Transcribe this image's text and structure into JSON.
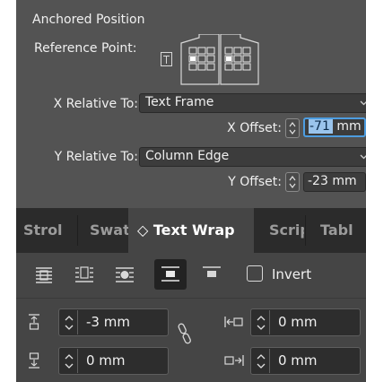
{
  "anchored_position": {
    "title": "Anchored Position",
    "reference_point_label": "Reference Point:",
    "x_relative_to_label": "X Relative To:",
    "x_relative_to_value": "Text Frame",
    "x_offset_label": "X Offset:",
    "x_offset_value": "-71",
    "x_offset_unit": " mm",
    "y_relative_to_label": "Y Relative To:",
    "y_relative_to_value": "Column Edge",
    "y_offset_label": "Y Offset:",
    "y_offset_value": "-23 mm"
  },
  "tabs": [
    {
      "label": "Strol",
      "active": false
    },
    {
      "label": "Swat",
      "active": false
    },
    {
      "label": "◇ Text Wrap",
      "active": true
    },
    {
      "label": "Scrip",
      "active": false
    },
    {
      "label": "Tabl",
      "active": false
    }
  ],
  "text_wrap": {
    "invert_label": "Invert",
    "invert_checked": false,
    "top_offset": "-3 mm",
    "bottom_offset": "0 mm",
    "left_offset": "0 mm",
    "right_offset": "0 mm"
  },
  "colors": {
    "panel_upper": "#535353",
    "panel_lower": "#454545",
    "tabbar": "#2b2b2b",
    "focus": "#4d9de0"
  }
}
